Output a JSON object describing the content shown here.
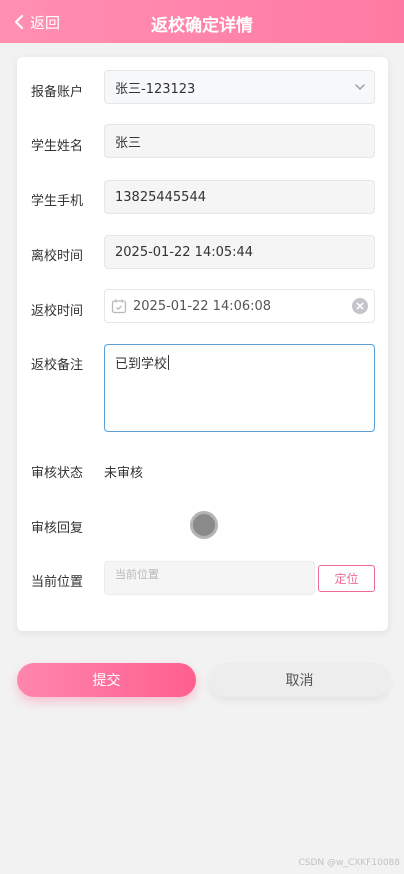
{
  "header": {
    "back_label": "返回",
    "title": "返校确定详情",
    "color": "#ff85ab"
  },
  "form": {
    "account": {
      "label": "报备账户",
      "value": "张三-123123"
    },
    "student_name": {
      "label": "学生姓名",
      "value": "张三"
    },
    "student_phone": {
      "label": "学生手机",
      "value": "13825445544"
    },
    "leave_time": {
      "label": "离校时间",
      "value": "2025-01-22 14:05:44"
    },
    "return_time": {
      "label": "返校时间",
      "value": "2025-01-22 14:06:08"
    },
    "return_note": {
      "label": "返校备注",
      "value": "已到学校"
    },
    "review_status": {
      "label": "审核状态",
      "value": "未审核"
    },
    "review_reply": {
      "label": "审核回复",
      "value": ""
    },
    "current_location": {
      "label": "当前位置",
      "placeholder": "当前位置",
      "locate_button": "定位"
    }
  },
  "actions": {
    "submit_label": "提交",
    "cancel_label": "取消",
    "accent": "#ff6b98"
  },
  "watermark": "CSDN @w_CXKF10088"
}
